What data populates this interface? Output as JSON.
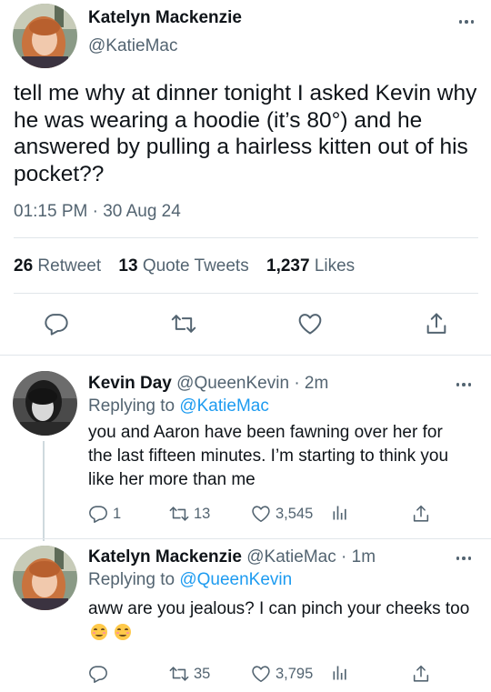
{
  "main_tweet": {
    "name": "Katelyn Mackenzie",
    "handle": "@KatieMac",
    "text": "tell me why at dinner tonight I asked Kevin why he was wearing a hoodie (it’s 80°) and he answered by pulling a hairless kitten out of his pocket??",
    "timestamp": "01:15 PM · 30 Aug 24",
    "stats": {
      "retweets_count": "26",
      "retweets_label": "Retweet",
      "quotes_count": "13",
      "quotes_label": "Quote Tweets",
      "likes_count": "1,237",
      "likes_label": "Likes"
    },
    "actions": [
      "reply-icon",
      "retweet-icon",
      "like-icon",
      "share-icon"
    ]
  },
  "replies": [
    {
      "name": "Kevin Day",
      "handle": "@QueenKevin",
      "time": "· 2m",
      "replying_prefix": "Replying to ",
      "replying_to": "@KatieMac",
      "text": "you and Aaron have been fawning over her for the last fifteen minutes. I’m starting to think you like her more than me",
      "counts": {
        "replies": "1",
        "retweets": "13",
        "likes": "3,545"
      }
    },
    {
      "name": "Katelyn Mackenzie",
      "handle": "@KatieMac",
      "time": "· 1m",
      "replying_prefix": "Replying to ",
      "replying_to": "@QueenKevin",
      "text": "aww are you jealous? I can pinch your cheeks too",
      "emojis": [
        "smiling-face-icon",
        "smiling-face-icon"
      ],
      "counts": {
        "replies": "",
        "retweets": "35",
        "likes": "3,795"
      }
    }
  ],
  "colors": {
    "accent": "#1d9bf0",
    "text_primary": "#0f1419",
    "text_secondary": "#536471",
    "icon": "#536471",
    "divider": "#e1e6ea"
  }
}
